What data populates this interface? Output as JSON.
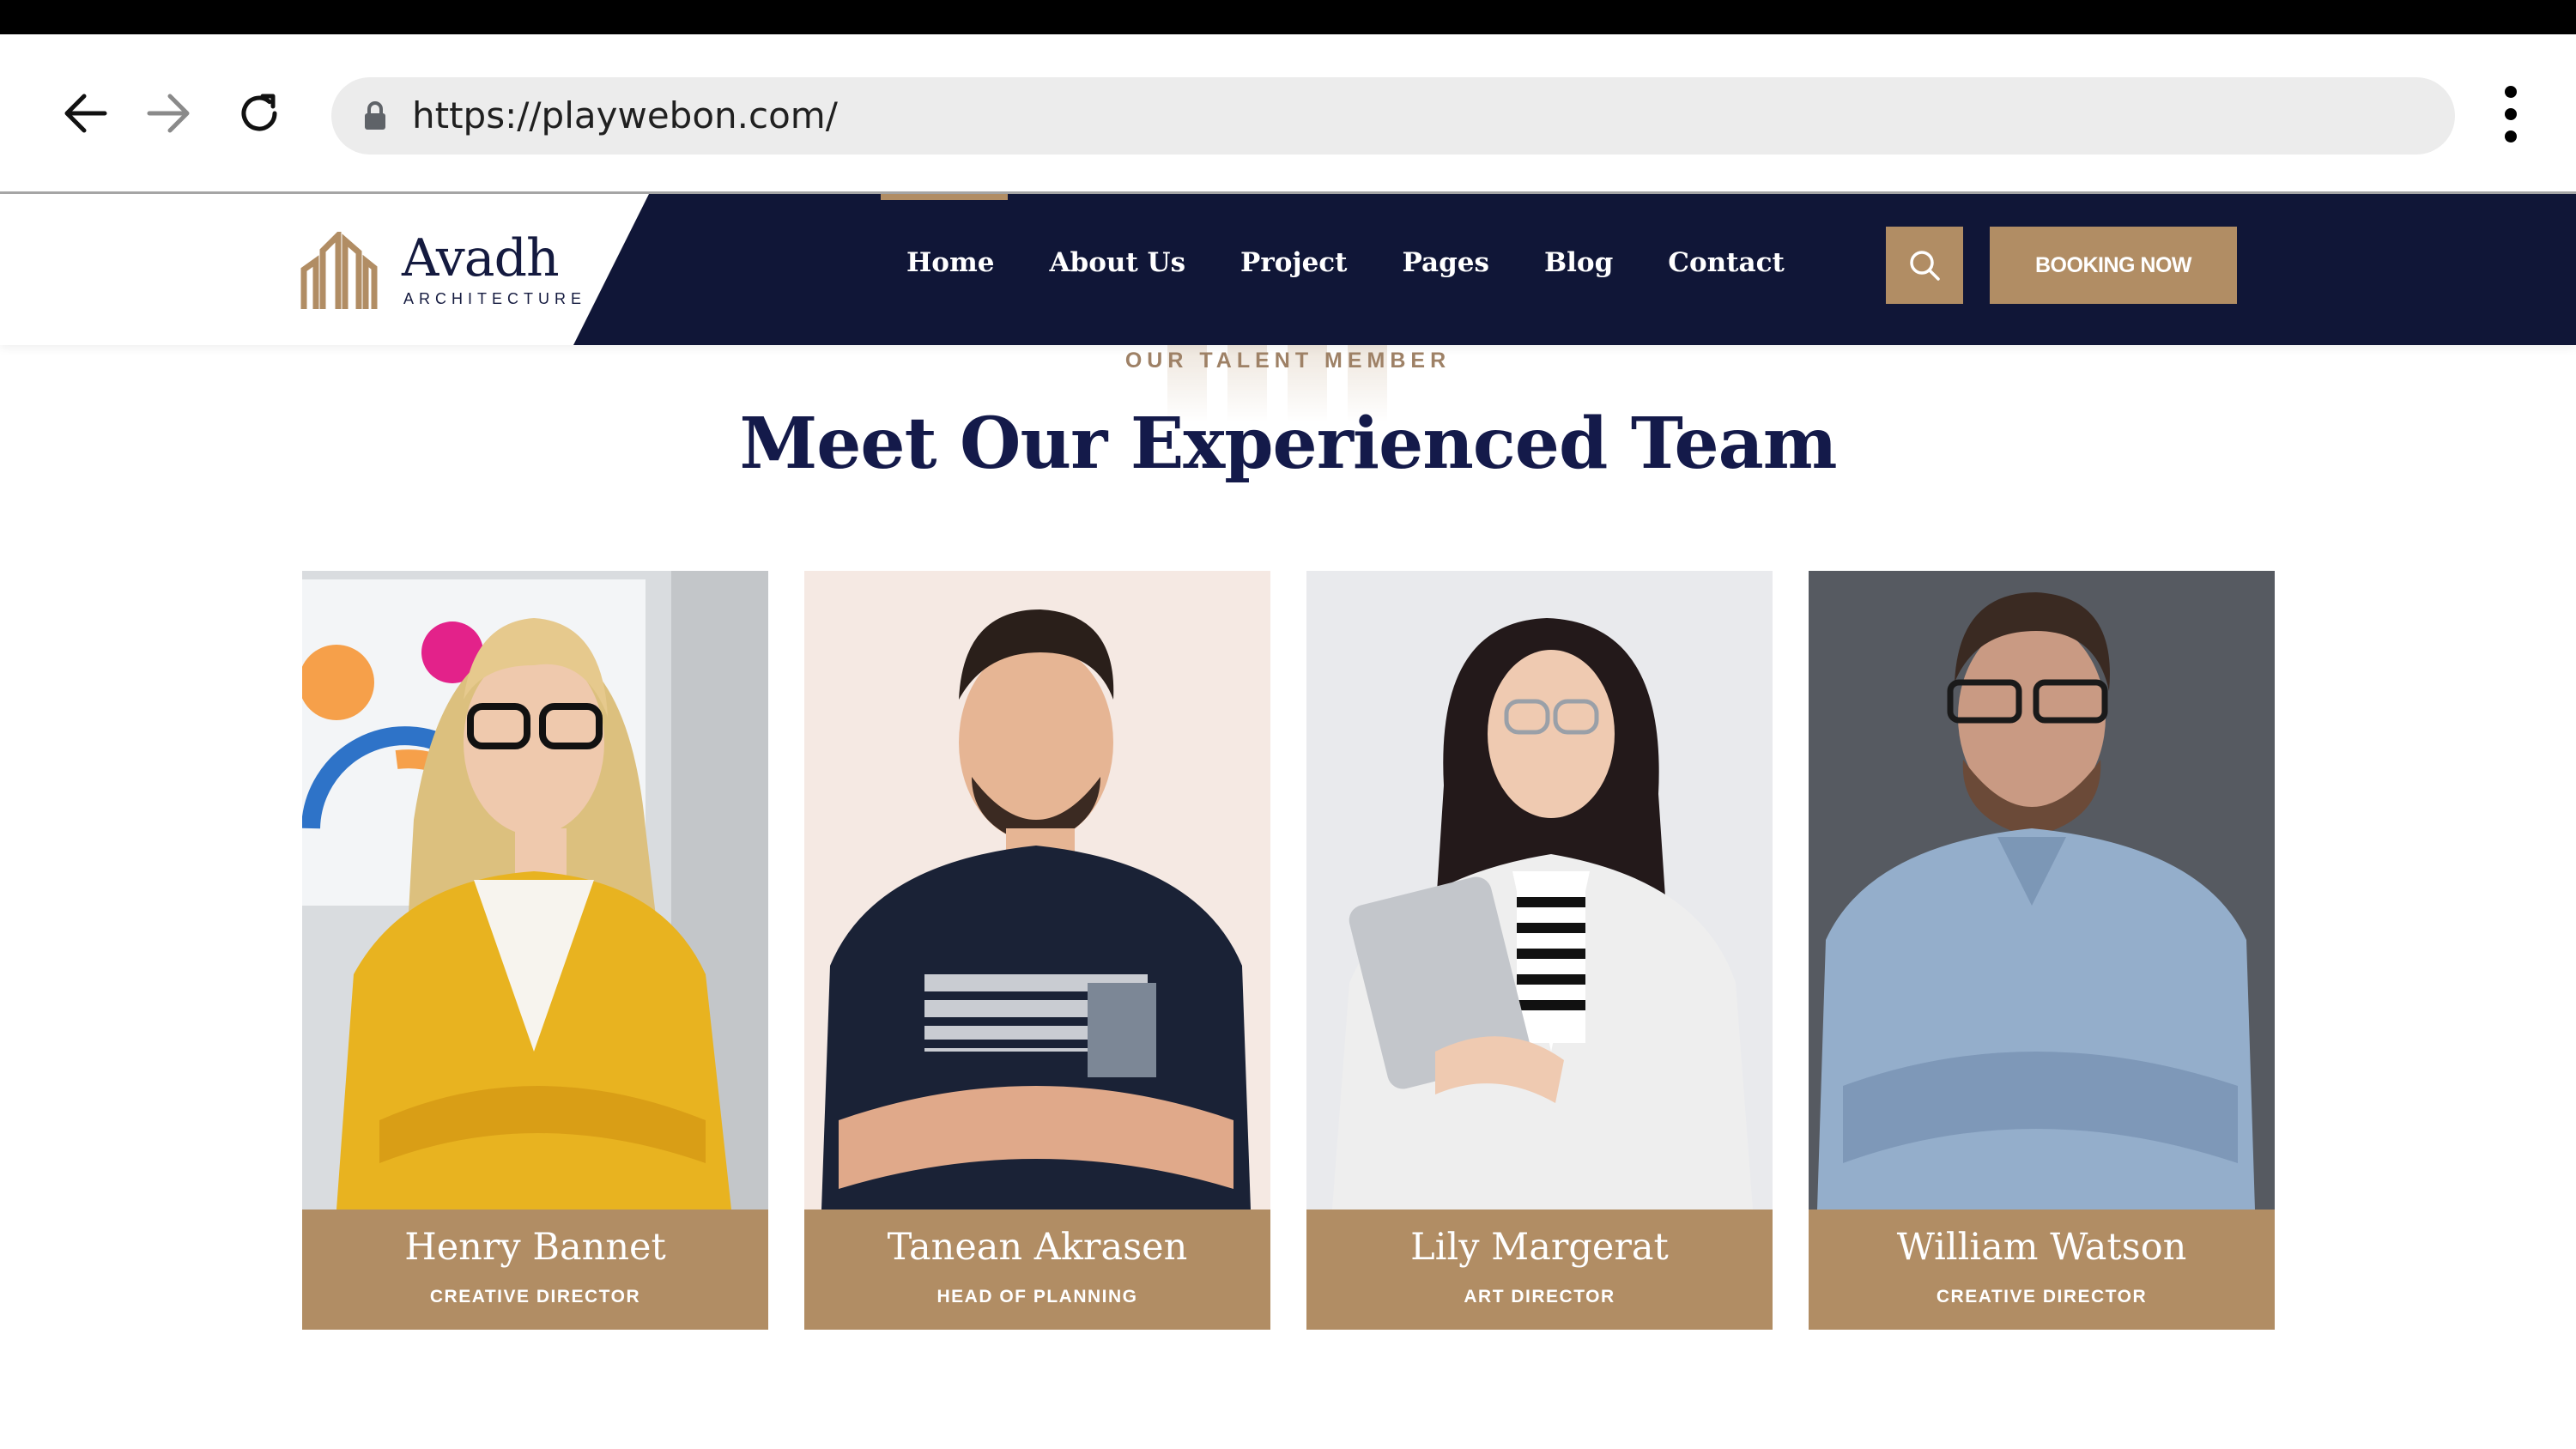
{
  "browser": {
    "url": "https://playwebon.com/",
    "icons": [
      "back-arrow-icon",
      "forward-arrow-icon",
      "reload-icon",
      "lock-icon",
      "kebab-menu-icon"
    ]
  },
  "site": {
    "logo": {
      "name": "Avadh",
      "tagline": "ARCHITECTURE"
    },
    "menu": [
      {
        "label": "Home",
        "active": true
      },
      {
        "label": "About Us"
      },
      {
        "label": "Project"
      },
      {
        "label": "Pages"
      },
      {
        "label": "Blog"
      },
      {
        "label": "Contact"
      }
    ],
    "booking_label": "BOOKING NOW",
    "colors": {
      "navy": "#101637",
      "gold": "#b18d64",
      "title": "#141a4a"
    }
  },
  "team": {
    "eyebrow": "OUR TALENT MEMBER",
    "title": "Meet Our Experienced Team",
    "members": [
      {
        "name": "Henry Bannet",
        "role": "CREATIVE DIRECTOR"
      },
      {
        "name": "Tanean Akrasen",
        "role": "HEAD OF PLANNING"
      },
      {
        "name": "Lily Margerat",
        "role": "ART DIRECTOR"
      },
      {
        "name": "William Watson",
        "role": "CREATIVE DIRECTOR"
      }
    ]
  }
}
